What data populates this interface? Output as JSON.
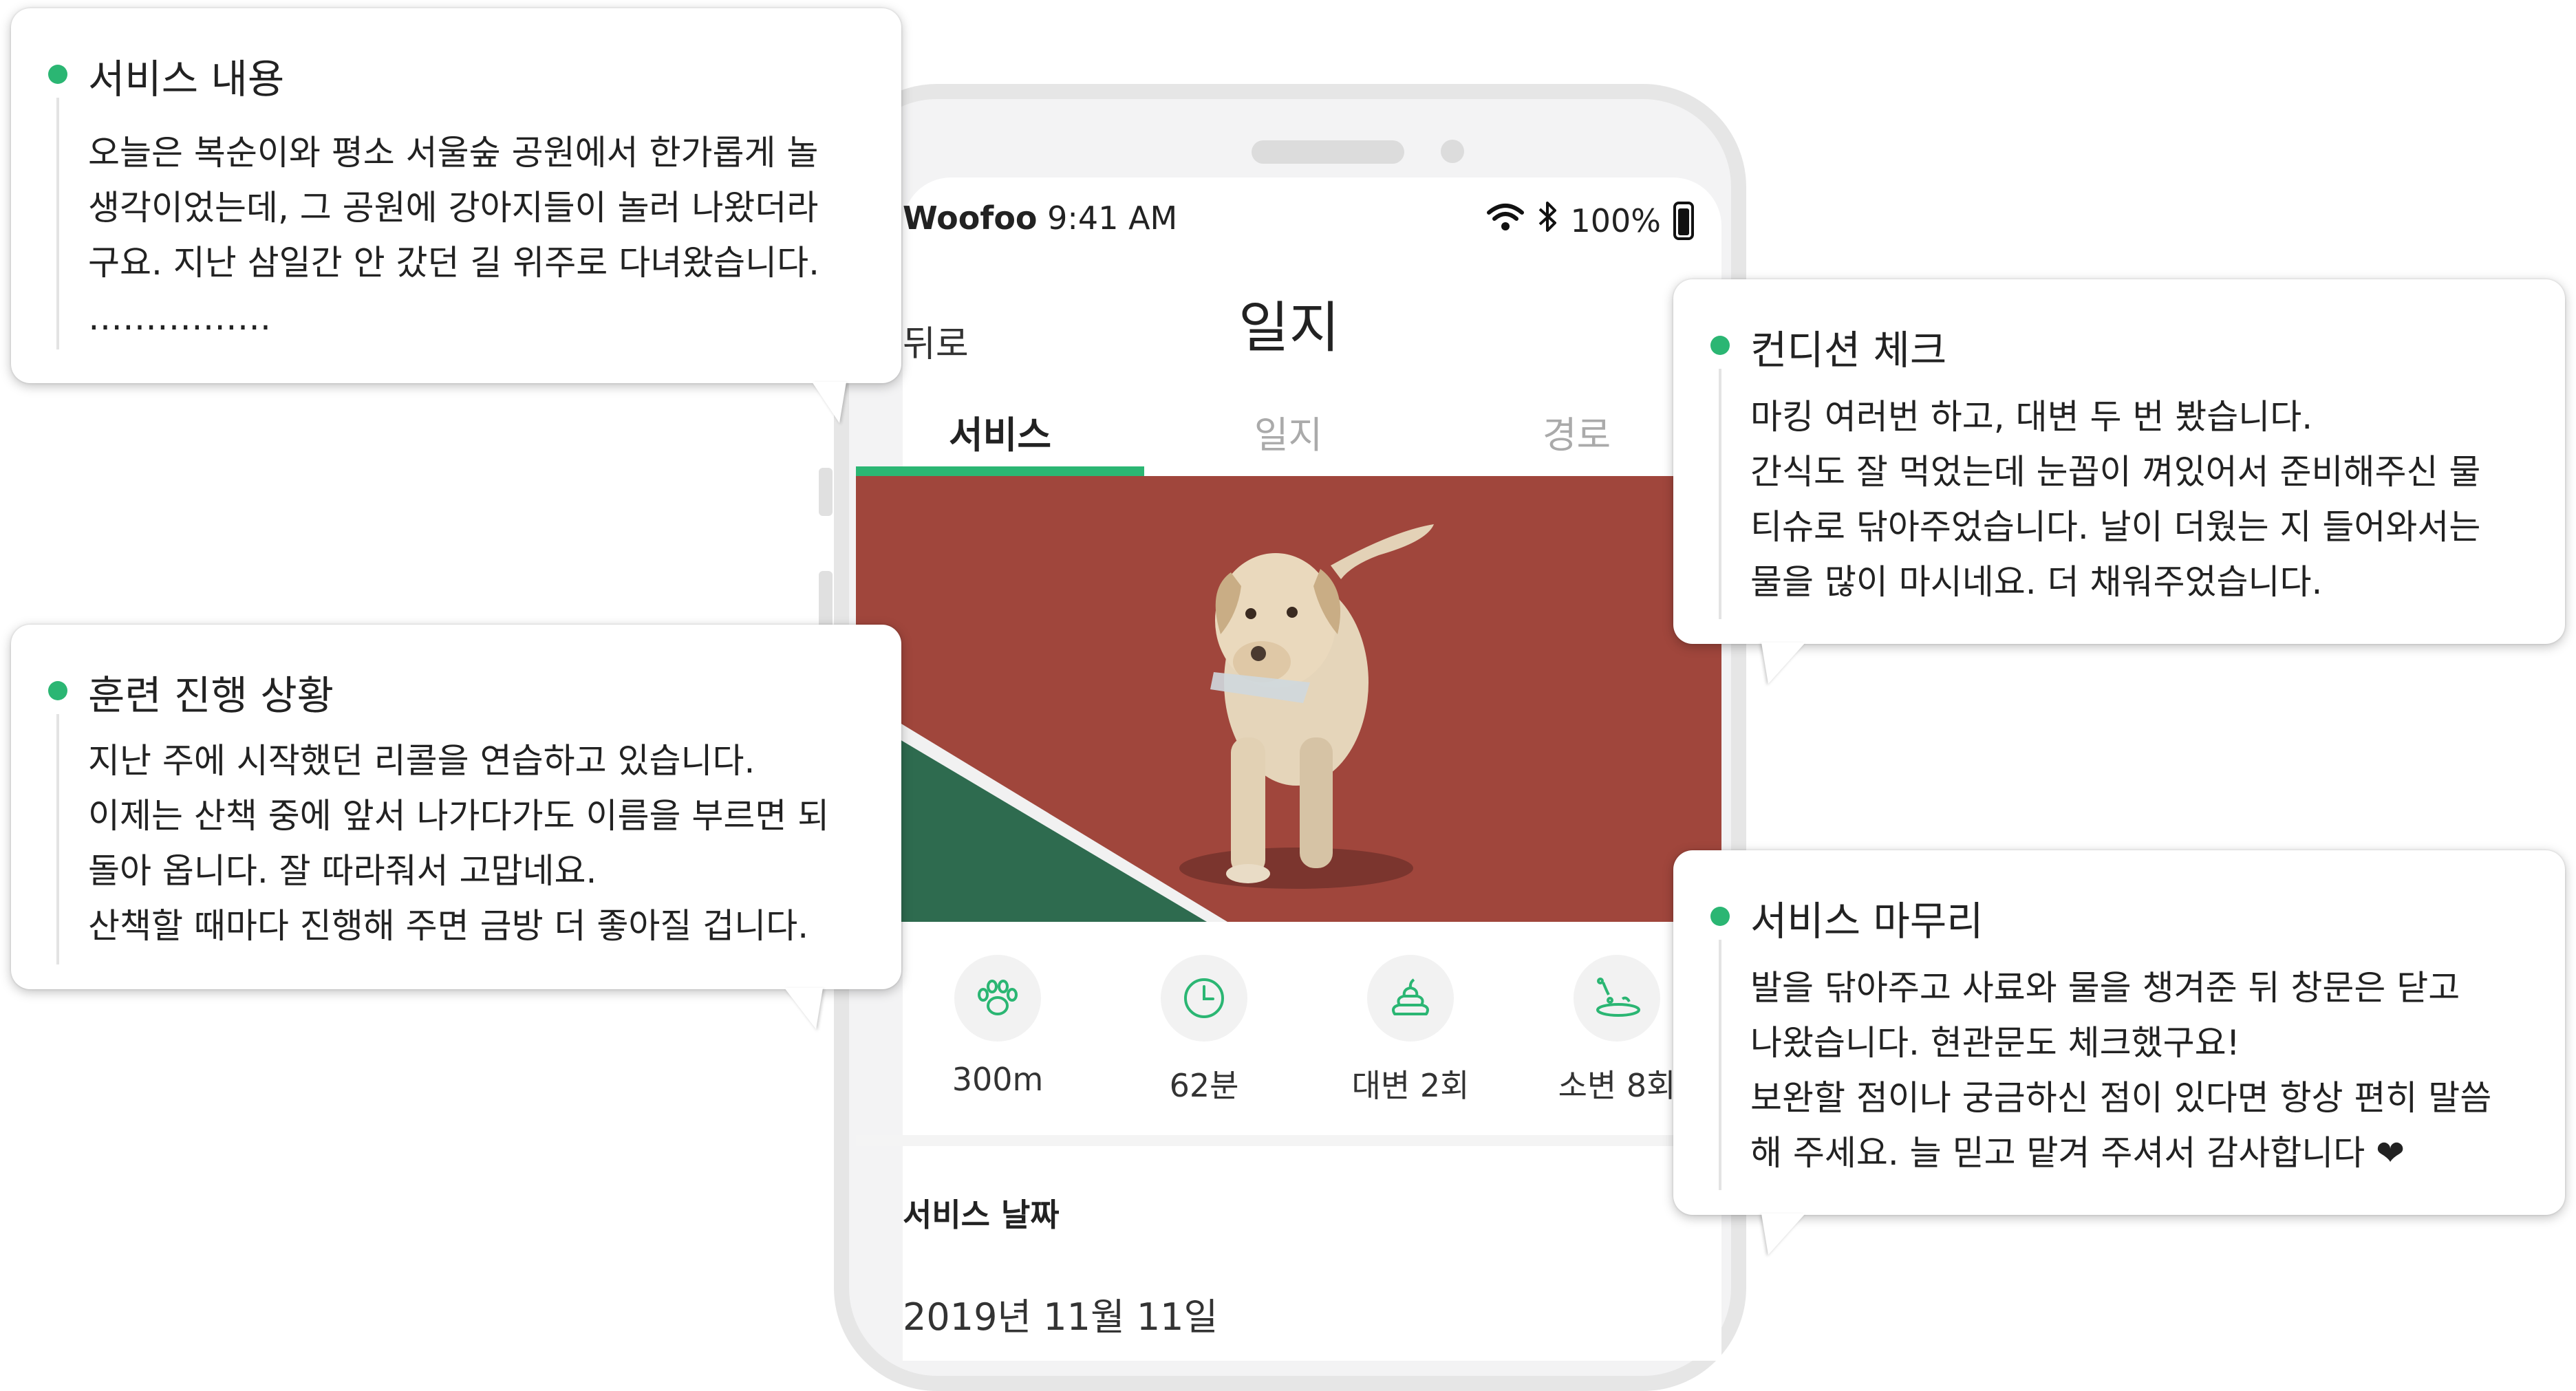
{
  "status_bar": {
    "brand": "Woofoo",
    "time": "9:41 AM",
    "battery": "100%"
  },
  "header": {
    "back_label": "뒤로",
    "title": "일지"
  },
  "tabs": [
    {
      "label": "서비스",
      "active": true
    },
    {
      "label": "일지",
      "active": false
    },
    {
      "label": "경로",
      "active": false
    }
  ],
  "stats": [
    {
      "icon": "paw-icon",
      "label": "300m"
    },
    {
      "icon": "clock-icon",
      "label": "62분"
    },
    {
      "icon": "poop-icon",
      "label": "대변 2회"
    },
    {
      "icon": "pee-icon",
      "label": "소변 8회"
    }
  ],
  "service_date": {
    "label": "서비스 날짜",
    "value": "2019년 11월 11일"
  },
  "callouts": {
    "service_content": {
      "title": "서비스 내용",
      "lines": [
        "오늘은 복순이와 평소 서울숲 공원에서 한가롭게 놀",
        "생각이었는데, 그 공원에 강아지들이 놀러 나왔더라",
        "구요. 지난 삼일간 안 갔던 길 위주로 다녀왔습니다.",
        "……………."
      ]
    },
    "training": {
      "title": "훈련 진행 상황",
      "lines": [
        "지난 주에 시작했던 리콜을 연습하고 있습니다.",
        "이제는 산책 중에 앞서 나가다가도 이름을 부르면 되",
        "돌아 옵니다. 잘 따라줘서 고맙네요.",
        "산책할 때마다 진행해 주면 금방 더 좋아질 겁니다."
      ]
    },
    "condition": {
      "title": "컨디션 체크",
      "lines": [
        "마킹 여러번 하고, 대변 두 번 봤습니다.",
        "간식도 잘 먹었는데 눈꼽이 껴있어서 준비해주신 물",
        "티슈로 닦아주었습니다. 날이 더웠는 지 들어와서는",
        "물을 많이 마시네요. 더 채워주었습니다."
      ]
    },
    "wrap_up": {
      "title": "서비스 마무리",
      "lines": [
        "발을 닦아주고 사료와 물을 챙겨준 뒤 창문은 닫고",
        "나왔습니다. 현관문도 체크했구요!",
        "보완할 점이나 궁금하신 점이 있다면 항상 편히 말씀",
        "해 주세요. 늘 믿고 맡겨 주셔서 감사합니다 ❤"
      ]
    }
  },
  "colors": {
    "accent": "#2bb673",
    "court_red": "#a0463c",
    "court_green": "#2e6b4f"
  }
}
